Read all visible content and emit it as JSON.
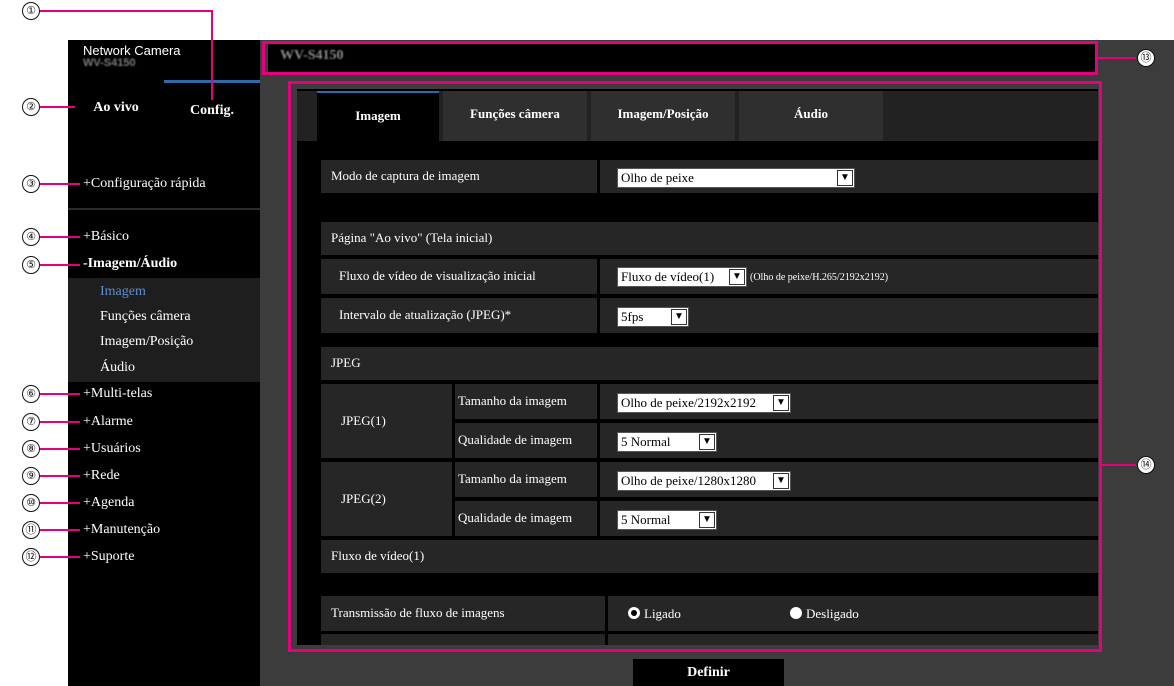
{
  "brand": {
    "line1": "Network Camera",
    "line2": "WV-S4150"
  },
  "title": "WV-S4150",
  "top_tabs": {
    "live": "Ao vivo",
    "config": "Config."
  },
  "menu": {
    "quick": "+Configuração rápida",
    "basic": "+Básico",
    "image_audio": "-Imagem/Áudio",
    "sub": [
      "Imagem",
      "Funções câmera",
      "Imagem/Posição",
      "Áudio"
    ],
    "multi": "+Multi-telas",
    "alarm": "+Alarme",
    "users": "+Usuários",
    "network": "+Rede",
    "schedule": "+Agenda",
    "maintenance": "+Manutenção",
    "support": "+Suporte"
  },
  "tabs": [
    "Imagem",
    "Funções câmera",
    "Imagem/Posição",
    "Áudio"
  ],
  "capture": {
    "label": "Modo de captura de imagem",
    "value": "Olho de peixe"
  },
  "live_page": {
    "section": "Página \"Ao vivo\" (Tela inicial)",
    "stream_label": "Fluxo de vídeo de visualização inicial",
    "stream_value": "Fluxo de vídeo(1)",
    "stream_note": "(Olho de peixe/H.265/2192x2192)",
    "refresh_label": "Intervalo de atualização (JPEG)*",
    "refresh_value": "5fps"
  },
  "jpeg": {
    "section": "JPEG",
    "j1_label": "JPEG(1)",
    "j2_label": "JPEG(2)",
    "size_label": "Tamanho da imagem",
    "quality_label": "Qualidade de imagem",
    "j1_size": "Olho de peixe/2192x2192",
    "j1_quality": "5 Normal",
    "j2_size": "Olho de peixe/1280x1280",
    "j2_quality": "5 Normal"
  },
  "stream1": {
    "section": "Fluxo de vídeo(1)",
    "transmission_label": "Transmissão de fluxo de imagens",
    "on_label": "Ligado",
    "off_label": "Desligado",
    "selected": "Ligado"
  },
  "set_button": "Definir",
  "callouts": [
    "①",
    "②",
    "③",
    "④",
    "⑤",
    "⑥",
    "⑦",
    "⑧",
    "⑨",
    "⑩",
    "⑪",
    "⑫",
    "⑬",
    "⑭"
  ],
  "colors": {
    "callout": "#e6007e",
    "tab_accent": "#2a6ba8"
  }
}
